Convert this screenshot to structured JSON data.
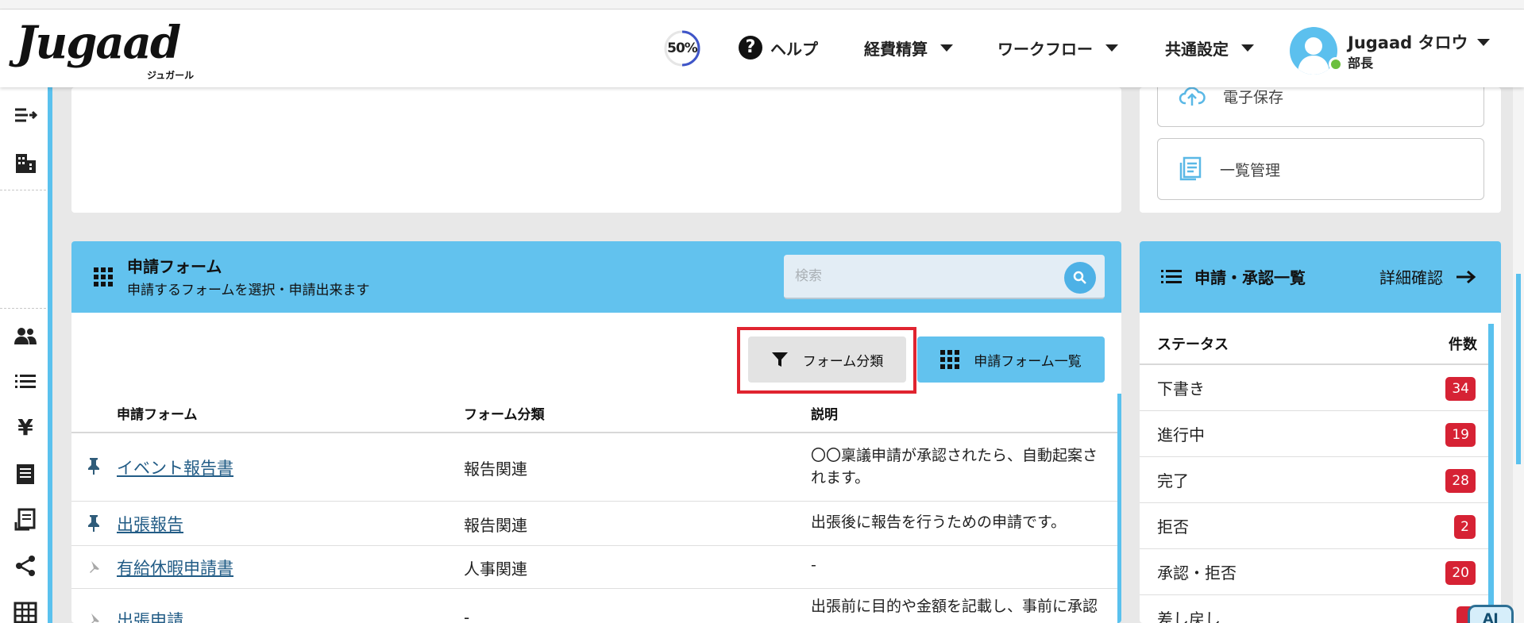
{
  "header": {
    "logo_text": "Jugaad",
    "logo_sub": "ジュガール",
    "progress": {
      "label": "50%",
      "value": 0.5
    },
    "help_label": "ヘルプ",
    "nav": [
      {
        "label": "経費精算"
      },
      {
        "label": "ワークフロー"
      },
      {
        "label": "共通設定"
      }
    ],
    "user": {
      "name": "Jugaad タロウ",
      "role": "部長"
    }
  },
  "side_buttons": [
    {
      "label": "電子保存",
      "icon": "cloud-upload-icon"
    },
    {
      "label": "一覧管理",
      "icon": "list-document-icon"
    }
  ],
  "form_panel": {
    "title": "申請フォーム",
    "subtitle": "申請するフォームを選択・申請出来ます",
    "search_placeholder": "検索",
    "filter_button": "フォーム分類",
    "list_button": "申請フォーム一覧",
    "columns": [
      "申請フォーム",
      "フォーム分類",
      "説明"
    ],
    "rows": [
      {
        "pinned": true,
        "name": "イベント報告書",
        "category": "報告関連",
        "description_1": "〇〇稟議申請が承認されたら、自動起案さ",
        "description_2": "れます。"
      },
      {
        "pinned": true,
        "name": "出張報告",
        "category": "報告関連",
        "description_1": "出張後に報告を行うための申請です。",
        "description_2": ""
      },
      {
        "pinned": false,
        "name": "有給休暇申請書",
        "category": "人事関連",
        "description_1": "-",
        "description_2": ""
      },
      {
        "pinned": false,
        "name": "出張申請",
        "category": "-",
        "description_1": "出張前に目的や金額を記載し、事前に承認",
        "description_2": ""
      }
    ]
  },
  "status_panel": {
    "title": "申請・承認一覧",
    "detail_link": "詳細確認",
    "columns": [
      "ステータス",
      "件数"
    ],
    "rows": [
      {
        "label": "下書き",
        "count": "34"
      },
      {
        "label": "進行中",
        "count": "19"
      },
      {
        "label": "完了",
        "count": "28"
      },
      {
        "label": "拒否",
        "count": "2"
      },
      {
        "label": "承認・拒否",
        "count": "20"
      },
      {
        "label": "差し戻し",
        "count": ""
      }
    ]
  },
  "ai_button": "AI",
  "sidebar_icons": [
    "collapse-menu-icon",
    "building-icon",
    "users-icon",
    "list-icon",
    "yen-icon",
    "receipt-icon",
    "invoice-icon",
    "share-icon",
    "table-icon"
  ],
  "colors": {
    "accent": "#62c2ee",
    "badge": "#d62234",
    "highlight": "#e02430",
    "link": "#225c86"
  }
}
